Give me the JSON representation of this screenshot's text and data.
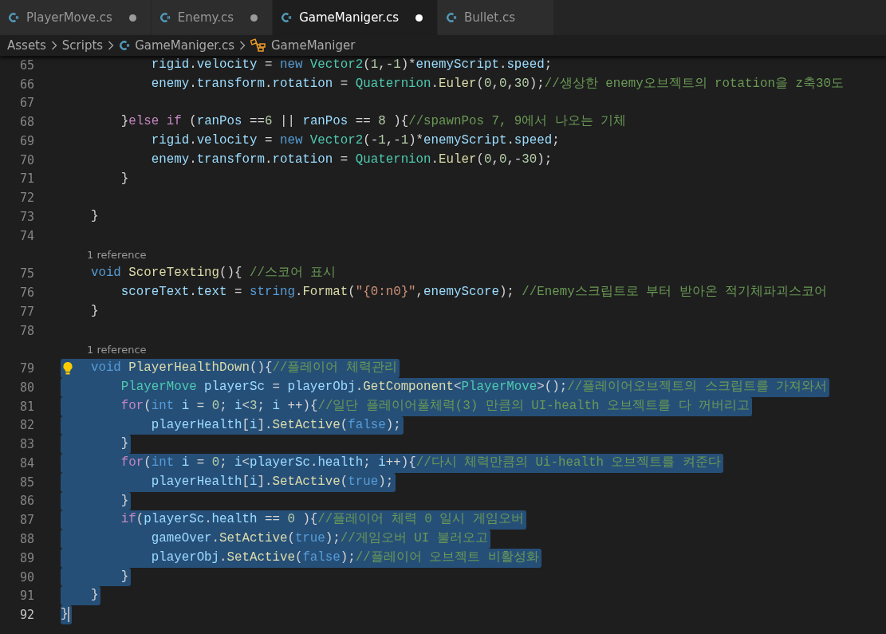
{
  "tabs": [
    {
      "label": "PlayerMove.cs",
      "selected": false,
      "modified": true
    },
    {
      "label": "Enemy.cs",
      "selected": false,
      "modified": true
    },
    {
      "label": "GameManiger.cs",
      "selected": true,
      "modified": true
    },
    {
      "label": "Bullet.cs",
      "selected": false,
      "modified": false
    }
  ],
  "breadcrumb": [
    {
      "label": "Assets",
      "kind": "folder"
    },
    {
      "label": "Scripts",
      "kind": "folder"
    },
    {
      "label": "GameManiger.cs",
      "kind": "file"
    },
    {
      "label": "GameManiger",
      "kind": "class"
    }
  ],
  "editor": {
    "lines": [
      {
        "kind": "code",
        "number": "65",
        "selected": false,
        "current": false,
        "tokens": [
          {
            "kind": "var",
            "text": "            rigid"
          },
          {
            "kind": "plain",
            "text": "."
          },
          {
            "kind": "var",
            "text": "velocity"
          },
          {
            "kind": "plain",
            "text": " = "
          },
          {
            "kind": "kw",
            "text": "new "
          },
          {
            "kind": "type",
            "text": "Vector2"
          },
          {
            "kind": "plain",
            "text": "("
          },
          {
            "kind": "num",
            "text": "1"
          },
          {
            "kind": "plain",
            "text": ",-"
          },
          {
            "kind": "num",
            "text": "1"
          },
          {
            "kind": "plain",
            "text": ")*"
          },
          {
            "kind": "var",
            "text": "enemyScript"
          },
          {
            "kind": "plain",
            "text": "."
          },
          {
            "kind": "var",
            "text": "speed"
          },
          {
            "kind": "plain",
            "text": ";"
          }
        ]
      },
      {
        "kind": "code",
        "number": "66",
        "selected": false,
        "current": false,
        "tokens": [
          {
            "kind": "var",
            "text": "            enemy"
          },
          {
            "kind": "plain",
            "text": "."
          },
          {
            "kind": "var",
            "text": "transform"
          },
          {
            "kind": "plain",
            "text": "."
          },
          {
            "kind": "var",
            "text": "rotation"
          },
          {
            "kind": "plain",
            "text": " = "
          },
          {
            "kind": "type",
            "text": "Quaternion"
          },
          {
            "kind": "plain",
            "text": "."
          },
          {
            "kind": "fn",
            "text": "Euler"
          },
          {
            "kind": "plain",
            "text": "("
          },
          {
            "kind": "num",
            "text": "0"
          },
          {
            "kind": "plain",
            "text": ","
          },
          {
            "kind": "num",
            "text": "0"
          },
          {
            "kind": "plain",
            "text": ","
          },
          {
            "kind": "num",
            "text": "30"
          },
          {
            "kind": "plain",
            "text": ");"
          },
          {
            "kind": "cmt",
            "text": "//생상한 enemy오브젝트의 rotation을 z축30도"
          }
        ]
      },
      {
        "kind": "code",
        "number": "67",
        "selected": false,
        "current": false
      },
      {
        "kind": "code",
        "number": "68",
        "selected": false,
        "current": false,
        "tokens": [
          {
            "kind": "plain",
            "text": "        }"
          },
          {
            "kind": "ctl",
            "text": "else if"
          },
          {
            "kind": "plain",
            "text": " ("
          },
          {
            "kind": "var",
            "text": "ranPos"
          },
          {
            "kind": "plain",
            "text": " =="
          },
          {
            "kind": "num",
            "text": "6"
          },
          {
            "kind": "plain",
            "text": " || "
          },
          {
            "kind": "var",
            "text": "ranPos"
          },
          {
            "kind": "plain",
            "text": " == "
          },
          {
            "kind": "num",
            "text": "8"
          },
          {
            "kind": "plain",
            "text": " ){"
          },
          {
            "kind": "cmt",
            "text": "//spawnPos 7, 9에서 나오는 기체"
          }
        ]
      },
      {
        "kind": "code",
        "number": "69",
        "selected": false,
        "current": false,
        "tokens": [
          {
            "kind": "var",
            "text": "            rigid"
          },
          {
            "kind": "plain",
            "text": "."
          },
          {
            "kind": "var",
            "text": "velocity"
          },
          {
            "kind": "plain",
            "text": " = "
          },
          {
            "kind": "kw",
            "text": "new "
          },
          {
            "kind": "type",
            "text": "Vector2"
          },
          {
            "kind": "plain",
            "text": "(-"
          },
          {
            "kind": "num",
            "text": "1"
          },
          {
            "kind": "plain",
            "text": ",-"
          },
          {
            "kind": "num",
            "text": "1"
          },
          {
            "kind": "plain",
            "text": ")*"
          },
          {
            "kind": "var",
            "text": "enemyScript"
          },
          {
            "kind": "plain",
            "text": "."
          },
          {
            "kind": "var",
            "text": "speed"
          },
          {
            "kind": "plain",
            "text": ";"
          }
        ]
      },
      {
        "kind": "code",
        "number": "70",
        "selected": false,
        "current": false,
        "tokens": [
          {
            "kind": "var",
            "text": "            enemy"
          },
          {
            "kind": "plain",
            "text": "."
          },
          {
            "kind": "var",
            "text": "transform"
          },
          {
            "kind": "plain",
            "text": "."
          },
          {
            "kind": "var",
            "text": "rotation"
          },
          {
            "kind": "plain",
            "text": " = "
          },
          {
            "kind": "type",
            "text": "Quaternion"
          },
          {
            "kind": "plain",
            "text": "."
          },
          {
            "kind": "fn",
            "text": "Euler"
          },
          {
            "kind": "plain",
            "text": "("
          },
          {
            "kind": "num",
            "text": "0"
          },
          {
            "kind": "plain",
            "text": ","
          },
          {
            "kind": "num",
            "text": "0"
          },
          {
            "kind": "plain",
            "text": ",-"
          },
          {
            "kind": "num",
            "text": "30"
          },
          {
            "kind": "plain",
            "text": ");"
          }
        ]
      },
      {
        "kind": "code",
        "number": "71",
        "selected": false,
        "current": false,
        "tokens": [
          {
            "kind": "plain",
            "text": "        }"
          }
        ]
      },
      {
        "kind": "code",
        "number": "72",
        "selected": false,
        "current": false
      },
      {
        "kind": "code",
        "number": "73",
        "selected": false,
        "current": false,
        "tokens": [
          {
            "kind": "plain",
            "text": "    }"
          }
        ]
      },
      {
        "kind": "code",
        "number": "74",
        "selected": false,
        "current": false
      },
      {
        "kind": "codelens",
        "text": "1 reference"
      },
      {
        "kind": "code",
        "number": "75",
        "selected": false,
        "current": false,
        "tokens": [
          {
            "kind": "kw",
            "text": "    void "
          },
          {
            "kind": "fn",
            "text": "ScoreTexting"
          },
          {
            "kind": "plain",
            "text": "(){ "
          },
          {
            "kind": "cmt",
            "text": "//스코어 표시"
          }
        ]
      },
      {
        "kind": "code",
        "number": "76",
        "selected": false,
        "current": false,
        "tokens": [
          {
            "kind": "var",
            "text": "        scoreText"
          },
          {
            "kind": "plain",
            "text": "."
          },
          {
            "kind": "var",
            "text": "text"
          },
          {
            "kind": "plain",
            "text": " = "
          },
          {
            "kind": "kw",
            "text": "string"
          },
          {
            "kind": "plain",
            "text": "."
          },
          {
            "kind": "fn",
            "text": "Format"
          },
          {
            "kind": "plain",
            "text": "("
          },
          {
            "kind": "str",
            "text": "\"{0:n0}\""
          },
          {
            "kind": "plain",
            "text": ","
          },
          {
            "kind": "var",
            "text": "enemyScore"
          },
          {
            "kind": "plain",
            "text": "); "
          },
          {
            "kind": "cmt",
            "text": "//Enemy스크립트로 부터 받아온 적기체파괴스코어"
          }
        ]
      },
      {
        "kind": "code",
        "number": "77",
        "selected": false,
        "current": false,
        "tokens": [
          {
            "kind": "plain",
            "text": "    }"
          }
        ]
      },
      {
        "kind": "code",
        "number": "78",
        "selected": false,
        "current": false
      },
      {
        "kind": "codelens",
        "text": "1 reference"
      },
      {
        "kind": "code",
        "number": "79",
        "selected": true,
        "current": false,
        "lightbulb": true,
        "tokens": [
          {
            "kind": "kw",
            "text": "    void "
          },
          {
            "kind": "fn",
            "text": "PlayerHealthDown"
          },
          {
            "kind": "plain",
            "text": "(){"
          },
          {
            "kind": "cmt",
            "text": "//플레이어 체력관리"
          }
        ]
      },
      {
        "kind": "code",
        "number": "80",
        "selected": true,
        "current": false,
        "tokens": [
          {
            "kind": "type",
            "text": "        PlayerMove"
          },
          {
            "kind": "var",
            "text": " playerSc"
          },
          {
            "kind": "plain",
            "text": " = "
          },
          {
            "kind": "var",
            "text": "playerObj"
          },
          {
            "kind": "plain",
            "text": "."
          },
          {
            "kind": "fn",
            "text": "GetComponent"
          },
          {
            "kind": "plain",
            "text": "<"
          },
          {
            "kind": "type",
            "text": "PlayerMove"
          },
          {
            "kind": "plain",
            "text": ">();"
          },
          {
            "kind": "cmt",
            "text": "//플레이어오브젝트의 스크립트를 가져와서"
          }
        ]
      },
      {
        "kind": "code",
        "number": "81",
        "selected": true,
        "current": false,
        "tokens": [
          {
            "kind": "ctl",
            "text": "        for"
          },
          {
            "kind": "plain",
            "text": "("
          },
          {
            "kind": "kw",
            "text": "int"
          },
          {
            "kind": "var",
            "text": " i"
          },
          {
            "kind": "plain",
            "text": " = "
          },
          {
            "kind": "num",
            "text": "0"
          },
          {
            "kind": "plain",
            "text": "; "
          },
          {
            "kind": "var",
            "text": "i"
          },
          {
            "kind": "plain",
            "text": "<"
          },
          {
            "kind": "num",
            "text": "3"
          },
          {
            "kind": "plain",
            "text": "; "
          },
          {
            "kind": "var",
            "text": "i"
          },
          {
            "kind": "plain",
            "text": " ++){"
          },
          {
            "kind": "cmt",
            "text": "//일단 플레이어풀체력(3) 만큼의 UI-health 오브젝트를 다 꺼버리고"
          }
        ]
      },
      {
        "kind": "code",
        "number": "82",
        "selected": true,
        "current": false,
        "tokens": [
          {
            "kind": "var",
            "text": "            playerHealth"
          },
          {
            "kind": "plain",
            "text": "["
          },
          {
            "kind": "var",
            "text": "i"
          },
          {
            "kind": "plain",
            "text": "]."
          },
          {
            "kind": "fn",
            "text": "SetActive"
          },
          {
            "kind": "plain",
            "text": "("
          },
          {
            "kind": "kw",
            "text": "false"
          },
          {
            "kind": "plain",
            "text": ");"
          }
        ]
      },
      {
        "kind": "code",
        "number": "83",
        "selected": true,
        "current": false,
        "tokens": [
          {
            "kind": "plain",
            "text": "        }"
          }
        ]
      },
      {
        "kind": "code",
        "number": "84",
        "selected": true,
        "current": false,
        "tokens": [
          {
            "kind": "ctl",
            "text": "        for"
          },
          {
            "kind": "plain",
            "text": "("
          },
          {
            "kind": "kw",
            "text": "int"
          },
          {
            "kind": "var",
            "text": " i"
          },
          {
            "kind": "plain",
            "text": " = "
          },
          {
            "kind": "num",
            "text": "0"
          },
          {
            "kind": "plain",
            "text": "; "
          },
          {
            "kind": "var",
            "text": "i"
          },
          {
            "kind": "plain",
            "text": "<"
          },
          {
            "kind": "var",
            "text": "playerSc"
          },
          {
            "kind": "plain",
            "text": "."
          },
          {
            "kind": "var",
            "text": "health"
          },
          {
            "kind": "plain",
            "text": "; "
          },
          {
            "kind": "var",
            "text": "i"
          },
          {
            "kind": "plain",
            "text": "++){"
          },
          {
            "kind": "cmt",
            "text": "//다시 체력만큼의 Ui-health 오브젝트를 켜준다"
          }
        ]
      },
      {
        "kind": "code",
        "number": "85",
        "selected": true,
        "current": false,
        "tokens": [
          {
            "kind": "var",
            "text": "            playerHealth"
          },
          {
            "kind": "plain",
            "text": "["
          },
          {
            "kind": "var",
            "text": "i"
          },
          {
            "kind": "plain",
            "text": "]."
          },
          {
            "kind": "fn",
            "text": "SetActive"
          },
          {
            "kind": "plain",
            "text": "("
          },
          {
            "kind": "kw",
            "text": "true"
          },
          {
            "kind": "plain",
            "text": ");"
          }
        ]
      },
      {
        "kind": "code",
        "number": "86",
        "selected": true,
        "current": false,
        "tokens": [
          {
            "kind": "plain",
            "text": "        }"
          }
        ]
      },
      {
        "kind": "code",
        "number": "87",
        "selected": true,
        "current": false,
        "tokens": [
          {
            "kind": "ctl",
            "text": "        if"
          },
          {
            "kind": "plain",
            "text": "("
          },
          {
            "kind": "var",
            "text": "playerSc"
          },
          {
            "kind": "plain",
            "text": "."
          },
          {
            "kind": "var",
            "text": "health"
          },
          {
            "kind": "plain",
            "text": " == "
          },
          {
            "kind": "num",
            "text": "0"
          },
          {
            "kind": "plain",
            "text": " ){"
          },
          {
            "kind": "cmt",
            "text": "//플레이어 체력 0 일시 게임오버"
          }
        ]
      },
      {
        "kind": "code",
        "number": "88",
        "selected": true,
        "current": false,
        "tokens": [
          {
            "kind": "var",
            "text": "            gameOver"
          },
          {
            "kind": "plain",
            "text": "."
          },
          {
            "kind": "fn",
            "text": "SetActive"
          },
          {
            "kind": "plain",
            "text": "("
          },
          {
            "kind": "kw",
            "text": "true"
          },
          {
            "kind": "plain",
            "text": ");"
          },
          {
            "kind": "cmt",
            "text": "//게임오버 UI 불러오고"
          }
        ]
      },
      {
        "kind": "code",
        "number": "89",
        "selected": true,
        "current": false,
        "tokens": [
          {
            "kind": "var",
            "text": "            playerObj"
          },
          {
            "kind": "plain",
            "text": "."
          },
          {
            "kind": "fn",
            "text": "SetActive"
          },
          {
            "kind": "plain",
            "text": "("
          },
          {
            "kind": "kw",
            "text": "false"
          },
          {
            "kind": "plain",
            "text": ");"
          },
          {
            "kind": "cmt",
            "text": "//플레이어 오브젝트 비활성화"
          }
        ]
      },
      {
        "kind": "code",
        "number": "90",
        "selected": true,
        "current": false,
        "tokens": [
          {
            "kind": "plain",
            "text": "        }"
          }
        ]
      },
      {
        "kind": "code",
        "number": "91",
        "selected": true,
        "current": false,
        "tokens": [
          {
            "kind": "plain",
            "text": "    }"
          }
        ]
      },
      {
        "kind": "code",
        "number": "92",
        "selected": true,
        "current": true,
        "tokens": [
          {
            "kind": "plain",
            "text": "}"
          }
        ]
      }
    ]
  }
}
